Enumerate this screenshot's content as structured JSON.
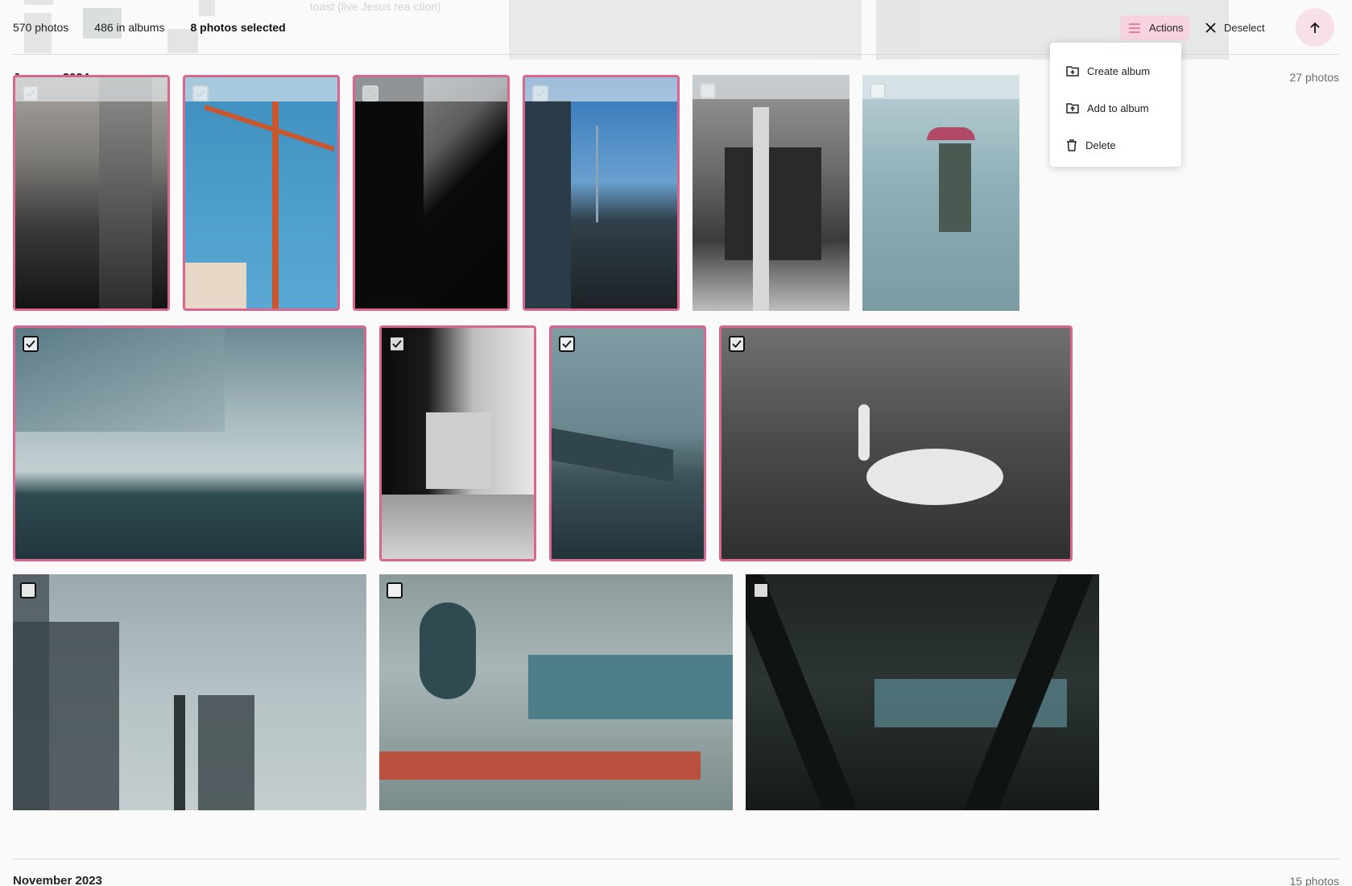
{
  "ghost": {
    "caption": "toast (live Jesus rea ction)"
  },
  "header": {
    "photos_count": "570 photos",
    "albums_count": "486 in albums",
    "selected_count": "8 photos selected",
    "actions_label": "Actions",
    "deselect_label": "Deselect"
  },
  "actions_menu": {
    "items": [
      {
        "label": "Create album",
        "icon": "folder-plus-icon"
      },
      {
        "label": "Add to album",
        "icon": "folder-upload-icon"
      },
      {
        "label": "Delete",
        "icon": "trash-icon"
      }
    ]
  },
  "months": [
    {
      "title": "January 2024",
      "count": "27 photos"
    },
    {
      "title": "November 2023",
      "count": "15 photos"
    }
  ],
  "photos": [
    {
      "subject": "building-walkway",
      "selected": true
    },
    {
      "subject": "construction-crane",
      "selected": true
    },
    {
      "subject": "dark-building-silhouette",
      "selected": true
    },
    {
      "subject": "tv-tower-street",
      "selected": true
    },
    {
      "subject": "bakery-storefront",
      "selected": false
    },
    {
      "subject": "umbrella-pedestrian",
      "selected": false
    },
    {
      "subject": "riverside-building",
      "selected": true
    },
    {
      "subject": "subway-station",
      "selected": true
    },
    {
      "subject": "railway-bridge",
      "selected": true
    },
    {
      "subject": "swan-on-water",
      "selected": true
    },
    {
      "subject": "crow-on-sign",
      "selected": false
    },
    {
      "subject": "ice-train-window",
      "selected": false
    },
    {
      "subject": "station-roof-beams",
      "selected": false
    }
  ],
  "colors": {
    "accent": "#d9668f",
    "accent_soft": "#f6d3df"
  }
}
